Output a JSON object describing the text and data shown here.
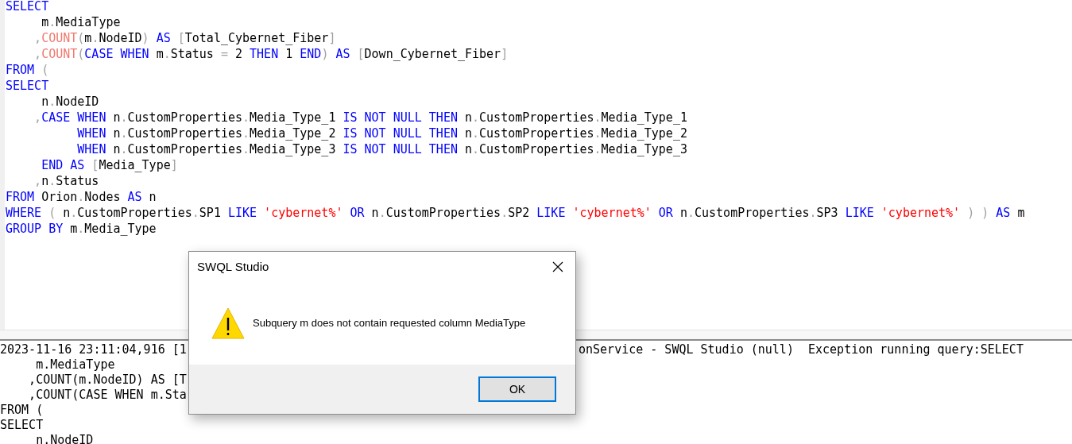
{
  "editor": {
    "lines": [
      [
        {
          "kind": "kw",
          "t": "SELECT"
        }
      ],
      [
        {
          "kind": "id",
          "t": "     m"
        },
        {
          "kind": "op",
          "t": "."
        },
        {
          "kind": "id",
          "t": "MediaType"
        }
      ],
      [
        {
          "kind": "op",
          "t": "    ,"
        },
        {
          "kind": "fn",
          "t": "COUNT"
        },
        {
          "kind": "op",
          "t": "("
        },
        {
          "kind": "id",
          "t": "m"
        },
        {
          "kind": "op",
          "t": "."
        },
        {
          "kind": "id",
          "t": "NodeID"
        },
        {
          "kind": "op",
          "t": ")"
        },
        {
          "kind": "kw",
          "t": " AS"
        },
        {
          "kind": "op",
          "t": " ["
        },
        {
          "kind": "id",
          "t": "Total_Cybernet_Fiber"
        },
        {
          "kind": "op",
          "t": "]"
        }
      ],
      [
        {
          "kind": "op",
          "t": "    ,"
        },
        {
          "kind": "fn",
          "t": "COUNT"
        },
        {
          "kind": "op",
          "t": "("
        },
        {
          "kind": "kw",
          "t": "CASE WHEN"
        },
        {
          "kind": "id",
          "t": " m"
        },
        {
          "kind": "op",
          "t": "."
        },
        {
          "kind": "id",
          "t": "Status"
        },
        {
          "kind": "op",
          "t": " ="
        },
        {
          "kind": "id",
          "t": " 2"
        },
        {
          "kind": "kw",
          "t": " THEN"
        },
        {
          "kind": "id",
          "t": " 1"
        },
        {
          "kind": "kw",
          "t": " END"
        },
        {
          "kind": "op",
          "t": ")"
        },
        {
          "kind": "kw",
          "t": " AS"
        },
        {
          "kind": "op",
          "t": " ["
        },
        {
          "kind": "id",
          "t": "Down_Cybernet_Fiber"
        },
        {
          "kind": "op",
          "t": "]"
        }
      ],
      [
        {
          "kind": "kw",
          "t": "FROM"
        },
        {
          "kind": "op",
          "t": " ("
        }
      ],
      [
        {
          "kind": "kw",
          "t": "SELECT"
        }
      ],
      [
        {
          "kind": "id",
          "t": "     n"
        },
        {
          "kind": "op",
          "t": "."
        },
        {
          "kind": "id",
          "t": "NodeID"
        }
      ],
      [
        {
          "kind": "op",
          "t": "    ,"
        },
        {
          "kind": "kw",
          "t": "CASE WHEN"
        },
        {
          "kind": "id",
          "t": " n"
        },
        {
          "kind": "op",
          "t": "."
        },
        {
          "kind": "id",
          "t": "CustomProperties"
        },
        {
          "kind": "op",
          "t": "."
        },
        {
          "kind": "id",
          "t": "Media_Type_1"
        },
        {
          "kind": "kw",
          "t": " IS NOT NULL THEN"
        },
        {
          "kind": "id",
          "t": " n"
        },
        {
          "kind": "op",
          "t": "."
        },
        {
          "kind": "id",
          "t": "CustomProperties"
        },
        {
          "kind": "op",
          "t": "."
        },
        {
          "kind": "id",
          "t": "Media_Type_1"
        }
      ],
      [
        {
          "kind": "kw",
          "t": "          WHEN"
        },
        {
          "kind": "id",
          "t": " n"
        },
        {
          "kind": "op",
          "t": "."
        },
        {
          "kind": "id",
          "t": "CustomProperties"
        },
        {
          "kind": "op",
          "t": "."
        },
        {
          "kind": "id",
          "t": "Media_Type_2"
        },
        {
          "kind": "kw",
          "t": " IS NOT NULL THEN"
        },
        {
          "kind": "id",
          "t": " n"
        },
        {
          "kind": "op",
          "t": "."
        },
        {
          "kind": "id",
          "t": "CustomProperties"
        },
        {
          "kind": "op",
          "t": "."
        },
        {
          "kind": "id",
          "t": "Media_Type_2"
        }
      ],
      [
        {
          "kind": "kw",
          "t": "          WHEN"
        },
        {
          "kind": "id",
          "t": " n"
        },
        {
          "kind": "op",
          "t": "."
        },
        {
          "kind": "id",
          "t": "CustomProperties"
        },
        {
          "kind": "op",
          "t": "."
        },
        {
          "kind": "id",
          "t": "Media_Type_3"
        },
        {
          "kind": "kw",
          "t": " IS NOT NULL THEN"
        },
        {
          "kind": "id",
          "t": " n"
        },
        {
          "kind": "op",
          "t": "."
        },
        {
          "kind": "id",
          "t": "CustomProperties"
        },
        {
          "kind": "op",
          "t": "."
        },
        {
          "kind": "id",
          "t": "Media_Type_3"
        }
      ],
      [
        {
          "kind": "kw",
          "t": "     END AS"
        },
        {
          "kind": "op",
          "t": " ["
        },
        {
          "kind": "id",
          "t": "Media_Type"
        },
        {
          "kind": "op",
          "t": "]"
        }
      ],
      [
        {
          "kind": "op",
          "t": "    ,"
        },
        {
          "kind": "id",
          "t": "n"
        },
        {
          "kind": "op",
          "t": "."
        },
        {
          "kind": "id",
          "t": "Status"
        }
      ],
      [
        {
          "kind": "kw",
          "t": "FROM"
        },
        {
          "kind": "id",
          "t": " Orion"
        },
        {
          "kind": "op",
          "t": "."
        },
        {
          "kind": "id",
          "t": "Nodes"
        },
        {
          "kind": "kw",
          "t": " AS"
        },
        {
          "kind": "id",
          "t": " n"
        }
      ],
      [
        {
          "kind": "kw",
          "t": "WHERE"
        },
        {
          "kind": "op",
          "t": " ("
        },
        {
          "kind": "id",
          "t": " n"
        },
        {
          "kind": "op",
          "t": "."
        },
        {
          "kind": "id",
          "t": "CustomProperties"
        },
        {
          "kind": "op",
          "t": "."
        },
        {
          "kind": "id",
          "t": "SP1"
        },
        {
          "kind": "kw",
          "t": " LIKE"
        },
        {
          "kind": "str",
          "t": " 'cybernet%'"
        },
        {
          "kind": "kw",
          "t": " OR"
        },
        {
          "kind": "id",
          "t": " n"
        },
        {
          "kind": "op",
          "t": "."
        },
        {
          "kind": "id",
          "t": "CustomProperties"
        },
        {
          "kind": "op",
          "t": "."
        },
        {
          "kind": "id",
          "t": "SP2"
        },
        {
          "kind": "kw",
          "t": " LIKE"
        },
        {
          "kind": "str",
          "t": " 'cybernet%'"
        },
        {
          "kind": "kw",
          "t": " OR"
        },
        {
          "kind": "id",
          "t": " n"
        },
        {
          "kind": "op",
          "t": "."
        },
        {
          "kind": "id",
          "t": "CustomProperties"
        },
        {
          "kind": "op",
          "t": "."
        },
        {
          "kind": "id",
          "t": "SP3"
        },
        {
          "kind": "kw",
          "t": " LIKE"
        },
        {
          "kind": "str",
          "t": " 'cybernet%'"
        },
        {
          "kind": "op",
          "t": " ) )"
        },
        {
          "kind": "kw",
          "t": " AS"
        },
        {
          "kind": "id",
          "t": " m"
        }
      ],
      [
        {
          "kind": "kw",
          "t": "GROUP BY"
        },
        {
          "kind": "id",
          "t": " m"
        },
        {
          "kind": "op",
          "t": "."
        },
        {
          "kind": "id",
          "t": "Media_Type"
        }
      ]
    ]
  },
  "log": {
    "lines": [
      {
        "left": "2023-11-16 23:11:04,916 [1",
        "right": "onService - SWQL Studio (null)  Exception running query:SELECT"
      },
      {
        "left": "     m.MediaType"
      },
      {
        "left": "    ,COUNT(m.NodeID) AS [T"
      },
      {
        "left": "    ,COUNT(CASE WHEN m.Sta"
      },
      {
        "left": "FROM ("
      },
      {
        "left": "SELECT"
      },
      {
        "left": "     n.NodeID"
      }
    ]
  },
  "dialog": {
    "title": "SWQL Studio",
    "message": "Subquery m does not contain requested column MediaType",
    "buttons": [
      "OK"
    ]
  }
}
